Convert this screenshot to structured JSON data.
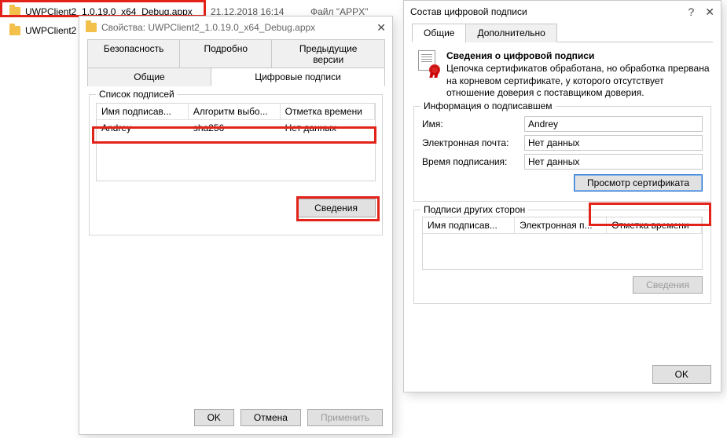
{
  "explorer": {
    "row1": {
      "name": "UWPClient2_1.0.19.0_x64_Debug.appx",
      "date": "21.12.2018 16:14",
      "type": "Файл \"APPX\""
    },
    "row2": {
      "name": "UWPClient2"
    }
  },
  "props": {
    "title": "Свойства: UWPClient2_1.0.19.0_x64_Debug.appx",
    "tabs": {
      "security": "Безопасность",
      "details": "Подробно",
      "prev": "Предыдущие версии",
      "general": "Общие",
      "digsig": "Цифровые подписи"
    },
    "group_label": "Список подписей",
    "columns": {
      "signer": "Имя подписав...",
      "algo": "Алгоритм выбо...",
      "ts": "Отметка времени"
    },
    "row": {
      "signer": "Andrey",
      "algo": "sha256",
      "ts": "Нет данных"
    },
    "details_btn": "Сведения",
    "ok": "OK",
    "cancel": "Отмена",
    "apply": "Применить"
  },
  "sig": {
    "title": "Состав цифровой подписи",
    "tabs": {
      "general": "Общие",
      "advanced": "Дополнительно"
    },
    "header": "Сведения о цифровой подписи",
    "body": "Цепочка сертификатов обработана, но обработка прервана на корневом сертификате, у которого отсутствует отношение доверия с поставщиком доверия.",
    "signer_group": "Информация о подписавшем",
    "name_label": "Имя:",
    "name_value": "Andrey",
    "email_label": "Электронная почта:",
    "email_value": "Нет данных",
    "time_label": "Время подписания:",
    "time_value": "Нет данных",
    "view_cert": "Просмотр сертификата",
    "counter_group": "Подписи других сторон",
    "counter_cols": {
      "signer": "Имя подписав...",
      "email": "Электронная п...",
      "ts": "Отметка времени"
    },
    "details_btn": "Сведения",
    "ok": "OK"
  }
}
